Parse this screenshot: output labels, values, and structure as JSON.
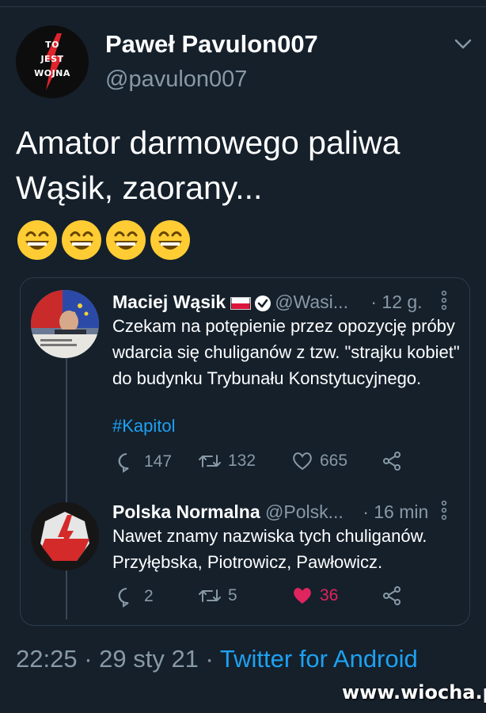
{
  "tweet": {
    "avatar_text": [
      "TO",
      "JEST",
      "WOJNA"
    ],
    "author_name": "Paweł Pavulon007",
    "author_handle": "@pavulon007",
    "text": "Amator darmowego paliwa Wąsik, zaorany...",
    "emojis": [
      "grinning-face",
      "grinning-face",
      "grinning-face",
      "grinning-face"
    ],
    "timestamp": "22:25 · 29 sty 21 · ",
    "source": "Twitter for Android"
  },
  "quoted": [
    {
      "name": "Maciej Wąsik",
      "handle": "@Wasi...",
      "time": "· 12 g.",
      "text": "Czekam na potępienie przez opozycję próby wdarcia się chuliganów z tzw. \"strajku kobiet\" do budynku Trybunału Konstytucyjnego.",
      "hashtag": "#Kapitol",
      "replies": "147",
      "retweets": "132",
      "likes": "665"
    },
    {
      "name": "Polska Normalna",
      "handle": "@Polsk...",
      "time": "· 16 min",
      "text": "Nawet znamy nazwiska tych chuliganów. Przyłębska, Piotrowicz, Pawłowicz.",
      "replies": "2",
      "retweets": "5",
      "likes": "36"
    }
  ],
  "watermark": "www.wiocha.pl",
  "colors": {
    "background": "#15202b",
    "link": "#1da1f2",
    "muted": "#8899a6",
    "like_active": "#e0245e"
  }
}
